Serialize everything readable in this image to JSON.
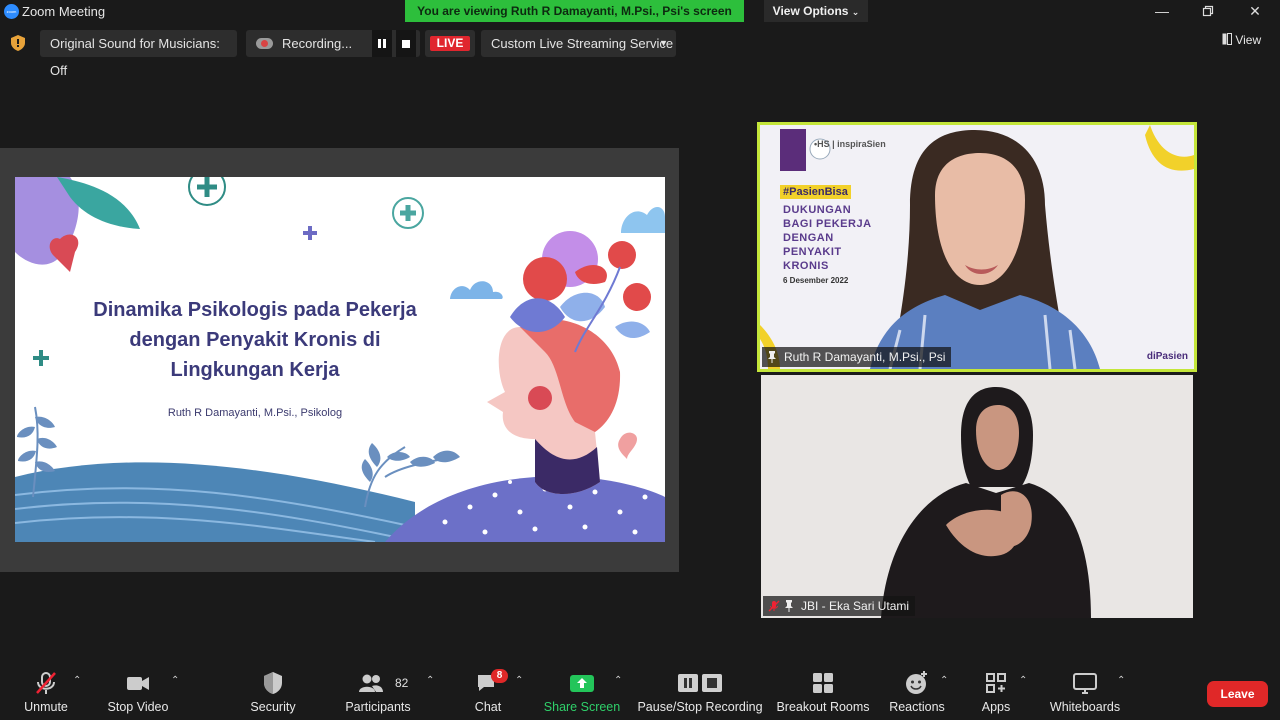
{
  "window": {
    "title": "Zoom Meeting",
    "logo_text": "zoom"
  },
  "banner": {
    "viewing": "You are viewing Ruth R Damayanti, M.Psi., Psi's screen",
    "view_options": "View Options"
  },
  "top_toolbar": {
    "original_sound": "Original Sound for Musicians: Off",
    "recording": "Recording...",
    "live": "LIVE",
    "stream_service": "Custom Live Streaming Service",
    "view": "View"
  },
  "slide": {
    "title_lines": [
      "Dinamika Psikologis pada Pekerja",
      "dengan Penyakit Kronis di",
      "Lingkungan Kerja"
    ],
    "author": "Ruth R Damayanti, M.Psi., Psikolog"
  },
  "speaker_tile": {
    "name": "Ruth R Damayanti, M.Psi., Psi",
    "hashtag": "#PasienBisa",
    "headline_lines": [
      "DUKUNGAN",
      "BAGI PEKERJA",
      "DENGAN",
      "PENYAKIT",
      "KRONIS"
    ],
    "date": "6 Desember 2022",
    "corner_text": "diPasien"
  },
  "interpreter_tile": {
    "name": "JBI - Eka Sari Utami"
  },
  "bottom_toolbar": {
    "unmute": "Unmute",
    "stop_video": "Stop Video",
    "security": "Security",
    "participants": "Participants",
    "participants_count": "82",
    "chat": "Chat",
    "chat_badge": "8",
    "share_screen": "Share Screen",
    "pause_stop_recording": "Pause/Stop Recording",
    "breakout_rooms": "Breakout Rooms",
    "reactions": "Reactions",
    "apps": "Apps",
    "whiteboards": "Whiteboards",
    "leave": "Leave"
  },
  "colors": {
    "live_red": "#e0262e",
    "banner_green": "#2dbf3c",
    "speaker_border": "#c4e63a",
    "share_green": "#23c55a"
  }
}
